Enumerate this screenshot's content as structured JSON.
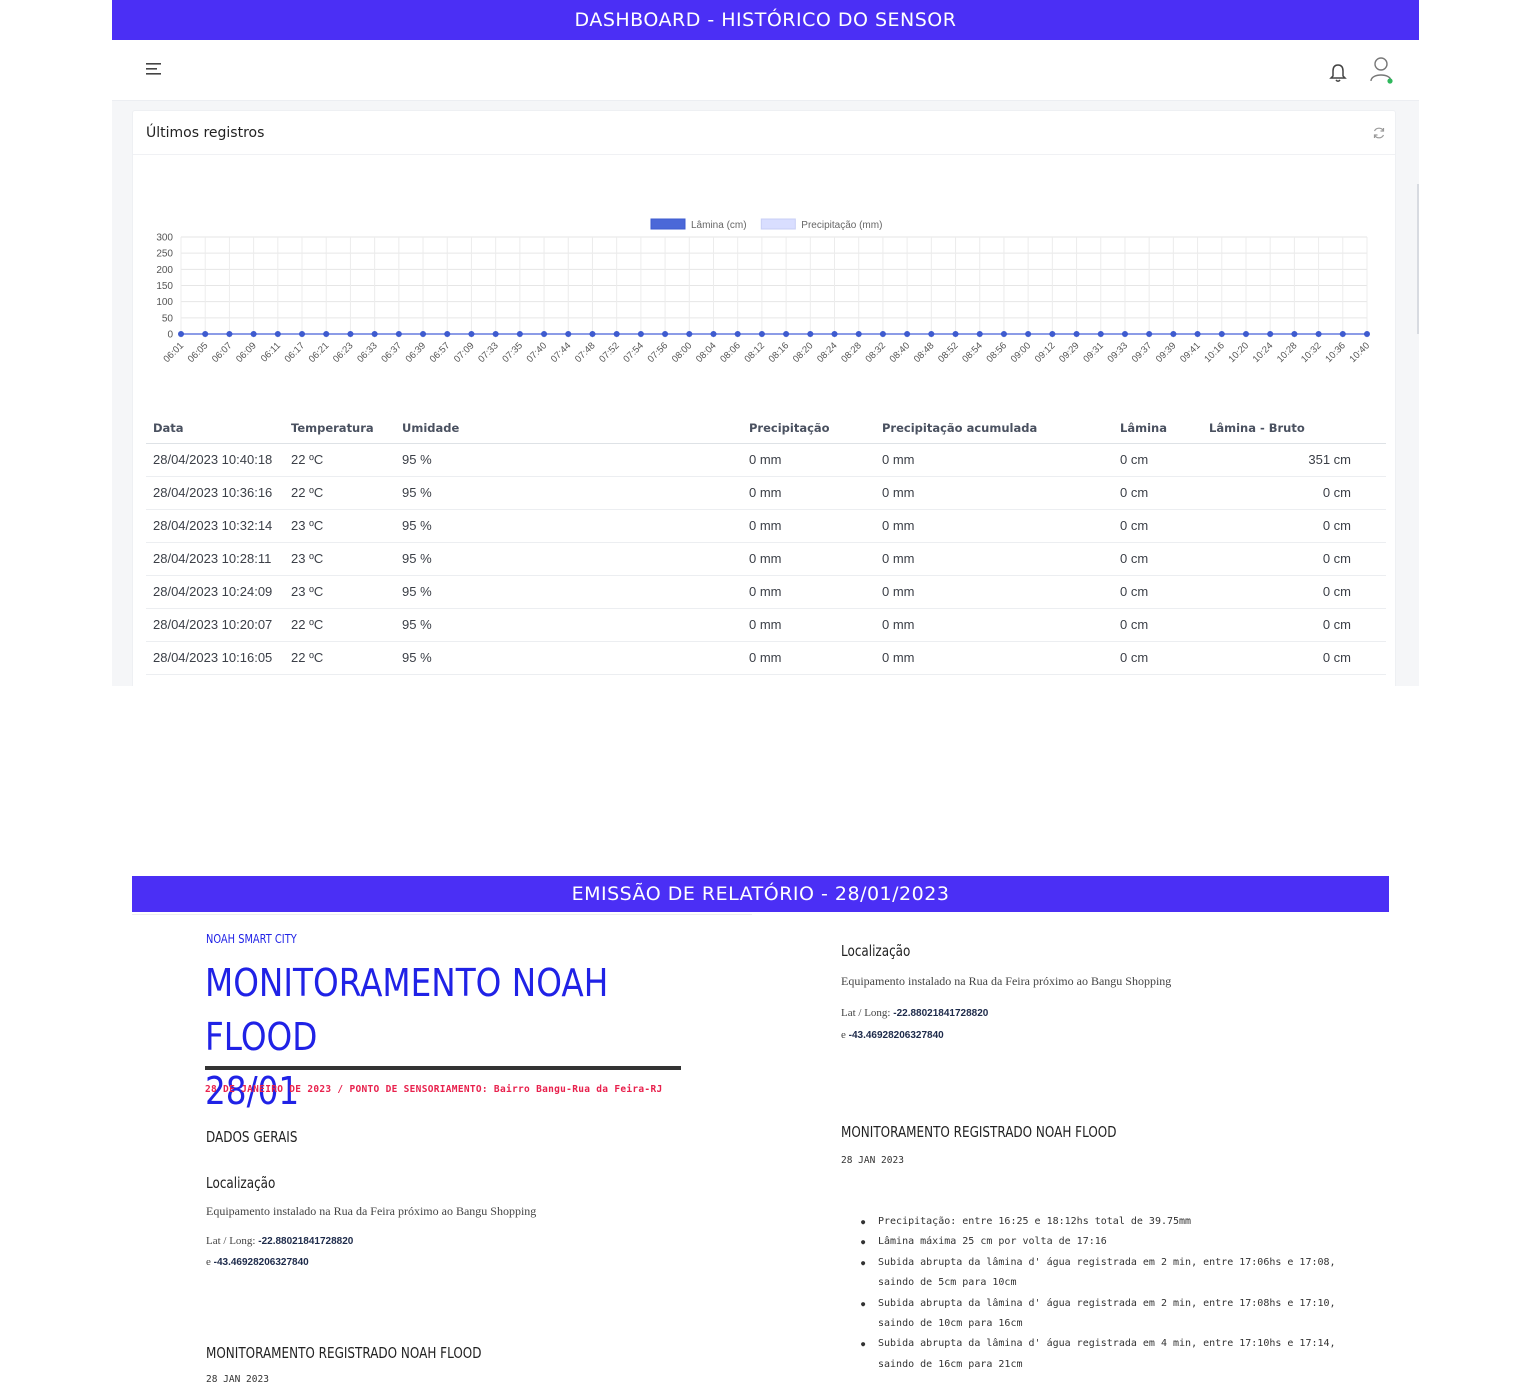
{
  "banners": {
    "top": "DASHBOARD - HISTÓRICO DO SENSOR",
    "bottom": "EMISSÃO DE RELATÓRIO - 28/01/2023"
  },
  "icons": {
    "menu": "menu-icon",
    "notifications": "bell-icon",
    "user": "user-icon",
    "refresh": "refresh-icon"
  },
  "colors": {
    "banner": "#4b2ff5",
    "series_lamina": "#4b68d8",
    "series_precip": "#d9deff",
    "report_accent": "#2022e6",
    "report_meta": "#e8214d",
    "status_online": "#2eb85c"
  },
  "card": {
    "title": "Últimos registros"
  },
  "chart_data": {
    "type": "line",
    "legend_position": "top",
    "grid": true,
    "ylim": [
      0,
      300
    ],
    "yticks": [
      0,
      50,
      100,
      150,
      200,
      250,
      300
    ],
    "x": [
      "06:01",
      "06:05",
      "06:07",
      "06:09",
      "06:11",
      "06:17",
      "06:21",
      "06:23",
      "06:33",
      "06:37",
      "06:39",
      "06:57",
      "07:09",
      "07:33",
      "07:35",
      "07:40",
      "07:44",
      "07:48",
      "07:52",
      "07:54",
      "07:56",
      "08:00",
      "08:04",
      "08:06",
      "08:12",
      "08:16",
      "08:20",
      "08:24",
      "08:28",
      "08:32",
      "08:40",
      "08:48",
      "08:52",
      "08:54",
      "08:56",
      "09:00",
      "09:12",
      "09:29",
      "09:31",
      "09:33",
      "09:37",
      "09:39",
      "09:41",
      "10:16",
      "10:20",
      "10:24",
      "10:28",
      "10:32",
      "10:36",
      "10:40"
    ],
    "series": [
      {
        "name": "Lâmina (cm)",
        "values": [
          0,
          0,
          0,
          0,
          0,
          0,
          0,
          0,
          0,
          0,
          0,
          0,
          0,
          0,
          0,
          0,
          0,
          0,
          0,
          0,
          0,
          0,
          0,
          0,
          0,
          0,
          0,
          0,
          0,
          0,
          0,
          0,
          0,
          0,
          0,
          0,
          0,
          0,
          0,
          0,
          0,
          0,
          0,
          0,
          0,
          0,
          0,
          0,
          0,
          0
        ]
      },
      {
        "name": "Precipitação (mm)",
        "values": [
          0,
          0,
          0,
          0,
          0,
          0,
          0,
          0,
          0,
          0,
          0,
          0,
          0,
          0,
          0,
          0,
          0,
          0,
          0,
          0,
          0,
          0,
          0,
          0,
          0,
          0,
          0,
          0,
          0,
          0,
          0,
          0,
          0,
          0,
          0,
          0,
          0,
          0,
          0,
          0,
          0,
          0,
          0,
          0,
          0,
          0,
          0,
          0,
          0,
          0
        ]
      }
    ]
  },
  "table": {
    "headers": [
      "Data",
      "Temperatura",
      "Umidade",
      "Precipitação",
      "Precipitação acumulada",
      "Lâmina",
      "Lâmina - Bruto"
    ],
    "rows": [
      [
        "28/04/2023 10:40:18",
        "22 ºC",
        "95 %",
        "0 mm",
        "0 mm",
        "0 cm",
        "351 cm"
      ],
      [
        "28/04/2023 10:36:16",
        "22 ºC",
        "95 %",
        "0 mm",
        "0 mm",
        "0 cm",
        "0 cm"
      ],
      [
        "28/04/2023 10:32:14",
        "23 ºC",
        "95 %",
        "0 mm",
        "0 mm",
        "0 cm",
        "0 cm"
      ],
      [
        "28/04/2023 10:28:11",
        "23 ºC",
        "95 %",
        "0 mm",
        "0 mm",
        "0 cm",
        "0 cm"
      ],
      [
        "28/04/2023 10:24:09",
        "23 ºC",
        "95 %",
        "0 mm",
        "0 mm",
        "0 cm",
        "0 cm"
      ],
      [
        "28/04/2023 10:20:07",
        "22 ºC",
        "95 %",
        "0 mm",
        "0 mm",
        "0 cm",
        "0 cm"
      ],
      [
        "28/04/2023 10:16:05",
        "22 ºC",
        "95 %",
        "0 mm",
        "0 mm",
        "0 cm",
        "0 cm"
      ]
    ]
  },
  "report": {
    "brand": "NOAH SMART CITY",
    "title_line1": "MONITORAMENTO NOAH FLOOD",
    "title_line2": "28/01",
    "meta": "28 DE JANEIRO DE 2023 / PONTO DE SENSORIAMENTO: Bairro Bangu-Rua da Feira-RJ",
    "section_general": "DADOS GERAIS",
    "location_heading": "Localização",
    "location_text": "Equipamento instalado na Rua da Feira próximo ao Bangu Shopping",
    "latlong_label": "Lat / Long:",
    "lat": "-22.88021841728820",
    "and_label": "e",
    "long": "-43.46928206327840",
    "monitor_heading": "MONITORAMENTO REGISTRADO NOAH  FLOOD",
    "monitor_date": "28 JAN 2023",
    "bullets": [
      "Precipitação: entre 16:25 e 18:12hs total de 39.75mm",
      "Lâmina máxima 25 cm por volta de 17:16",
      "Subida abrupta da lâmina d' água registrada em 2 min, entre 17:06hs e 17:08, saindo de 5cm para 10cm",
      "Subida abrupta da lâmina d' água registrada em 2 min, entre 17:08hs e 17:10, saindo de 10cm para 16cm",
      "Subida abrupta da lâmina d' água registrada em 4 min, entre 17:10hs e 17:14, saindo de 16cm para 21cm"
    ]
  }
}
